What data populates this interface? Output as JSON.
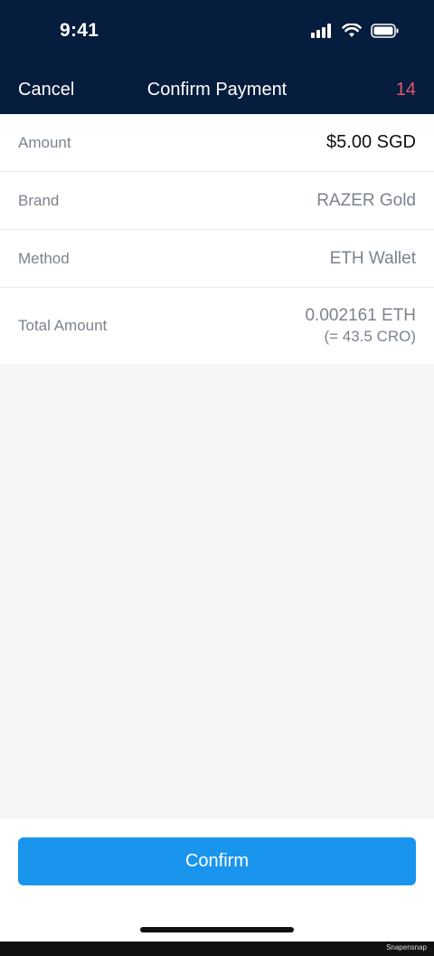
{
  "status_bar": {
    "time": "9:41",
    "icons": [
      "cellular-signal-icon",
      "wifi-icon",
      "battery-icon"
    ]
  },
  "nav": {
    "cancel_label": "Cancel",
    "title": "Confirm Payment",
    "countdown": "14"
  },
  "details": {
    "amount": {
      "label": "Amount",
      "value": "$5.00 SGD"
    },
    "brand": {
      "label": "Brand",
      "value": "RAZER Gold"
    },
    "method": {
      "label": "Method",
      "value": "ETH Wallet"
    },
    "total": {
      "label": "Total Amount",
      "value": "0.002161 ETH",
      "sub_value": "(= 43.5 CRO)"
    }
  },
  "footer": {
    "confirm_label": "Confirm"
  },
  "watermark": "Snapensnap",
  "colors": {
    "header_bg": "#061d3d",
    "accent": "#1a95ee",
    "countdown": "#e0576e",
    "page_bg": "#f4f6f8"
  }
}
